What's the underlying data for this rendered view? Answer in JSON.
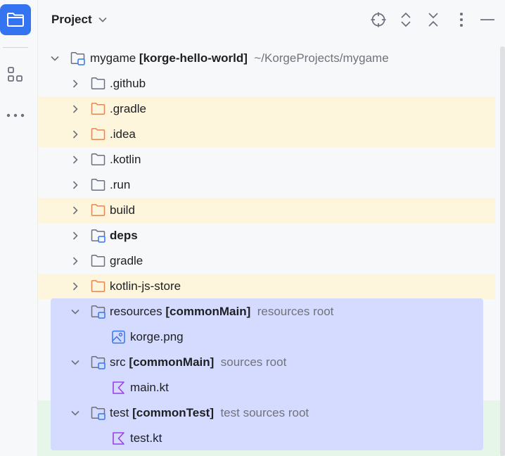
{
  "panel": {
    "title": "Project"
  },
  "colors": {
    "accent": "#3574f0",
    "highlight_excluded": "#fdf6dc",
    "selection": "#d5dbff",
    "test_area": "#e6f7e9"
  },
  "icons": {
    "strip": [
      "folder-icon",
      "structure-icon",
      "more-horizontal-icon"
    ],
    "header": [
      "locate-icon",
      "expand-all-icon",
      "collapse-all-icon",
      "options-icon",
      "hide-icon"
    ]
  },
  "tree": {
    "root": {
      "name": "mygame",
      "module": "[korge-hello-world]",
      "path": "~/KorgeProjects/mygame"
    },
    "items": [
      {
        "name": ".github"
      },
      {
        "name": ".gradle"
      },
      {
        "name": ".idea"
      },
      {
        "name": ".kotlin"
      },
      {
        "name": ".run"
      },
      {
        "name": "build"
      },
      {
        "name": "deps"
      },
      {
        "name": "gradle"
      },
      {
        "name": "kotlin-js-store"
      },
      {
        "name": "resources",
        "tag": "[commonMain]",
        "hint": "resources root"
      },
      {
        "name": "korge.png"
      },
      {
        "name": "src",
        "tag": "[commonMain]",
        "hint": "sources root"
      },
      {
        "name": "main.kt"
      },
      {
        "name": "test",
        "tag": "[commonTest]",
        "hint": "test sources root"
      },
      {
        "name": "test.kt"
      }
    ]
  }
}
